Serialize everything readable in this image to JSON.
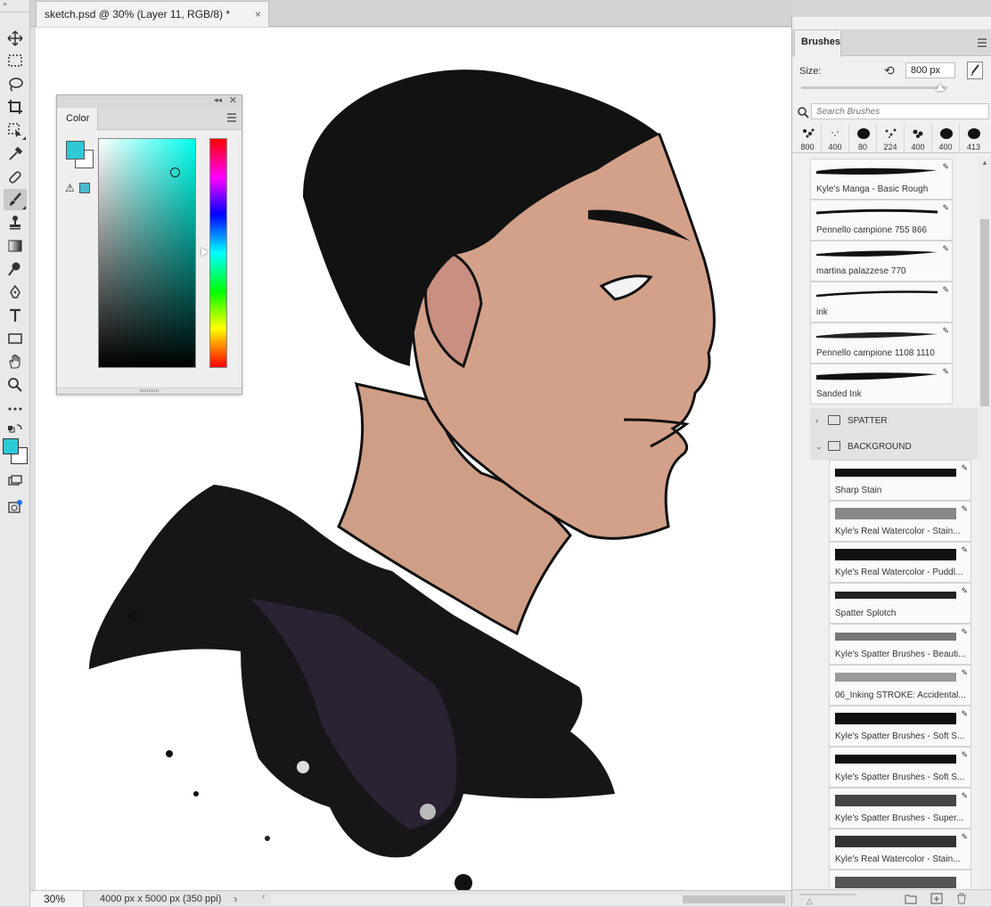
{
  "document": {
    "tab_title": "sketch.psd @ 30% (Layer 11, RGB/8) *",
    "close_glyph": "×"
  },
  "status": {
    "zoom": "30%",
    "doc_size": "4000 px x 5000 px (350 ppi)",
    "arrow": "›"
  },
  "tools": [
    "move-tool",
    "marquee-tool",
    "lasso-tool",
    "crop-tool",
    "object-select-tool",
    "eyedropper-tool",
    "healing-tool",
    "brush-tool",
    "stamp-tool",
    "gradient-tool",
    "burn-tool",
    "pen-tool",
    "type-tool",
    "rectangle-tool",
    "hand-tool",
    "zoom-tool",
    "more-tools"
  ],
  "color_panel": {
    "tab_label": "Color",
    "foreground": "#2fc9d6",
    "background": "#ffffff",
    "gamut_warning": "⚠"
  },
  "brushes_panel": {
    "tab_label": "Brushes",
    "size_label": "Size:",
    "size_value": "800 px",
    "search_placeholder": "Search Brushes",
    "recent_sizes": [
      "800",
      "400",
      "80",
      "224",
      "400",
      "400",
      "413"
    ],
    "items": [
      {
        "name": "Kyle's Manga - Basic Rough"
      },
      {
        "name": "Pennello campione 755 866"
      },
      {
        "name": "martina palazzese 770"
      },
      {
        "name": "ink"
      },
      {
        "name": "Pennello campione 1108 1110"
      },
      {
        "name": "Sanded Ink"
      }
    ],
    "groups": [
      {
        "name": "SPATTER",
        "chevron": "›"
      },
      {
        "name": "BACKGROUND",
        "chevron": "⌄"
      }
    ],
    "background_items": [
      {
        "name": "Sharp Stain"
      },
      {
        "name": "Kyle's Real Watercolor - Stain..."
      },
      {
        "name": "Kyle's Real Watercolor - Puddl..."
      },
      {
        "name": "Spatter Splotch"
      },
      {
        "name": "Kyle's Spatter Brushes - Beauti..."
      },
      {
        "name": "06_Inking STROKE: Accidental..."
      },
      {
        "name": "Kyle's Spatter Brushes - Soft S..."
      },
      {
        "name": "Kyle's Spatter Brushes - Soft S..."
      },
      {
        "name": "Kyle's Spatter Brushes - Super..."
      },
      {
        "name": "Kyle's Real Watercolor - Stain..."
      }
    ]
  },
  "colors": {
    "accent": "#2fc9d6",
    "skin": "#d3a18a",
    "hair": "#121212",
    "hoodie": "#2a2230"
  }
}
